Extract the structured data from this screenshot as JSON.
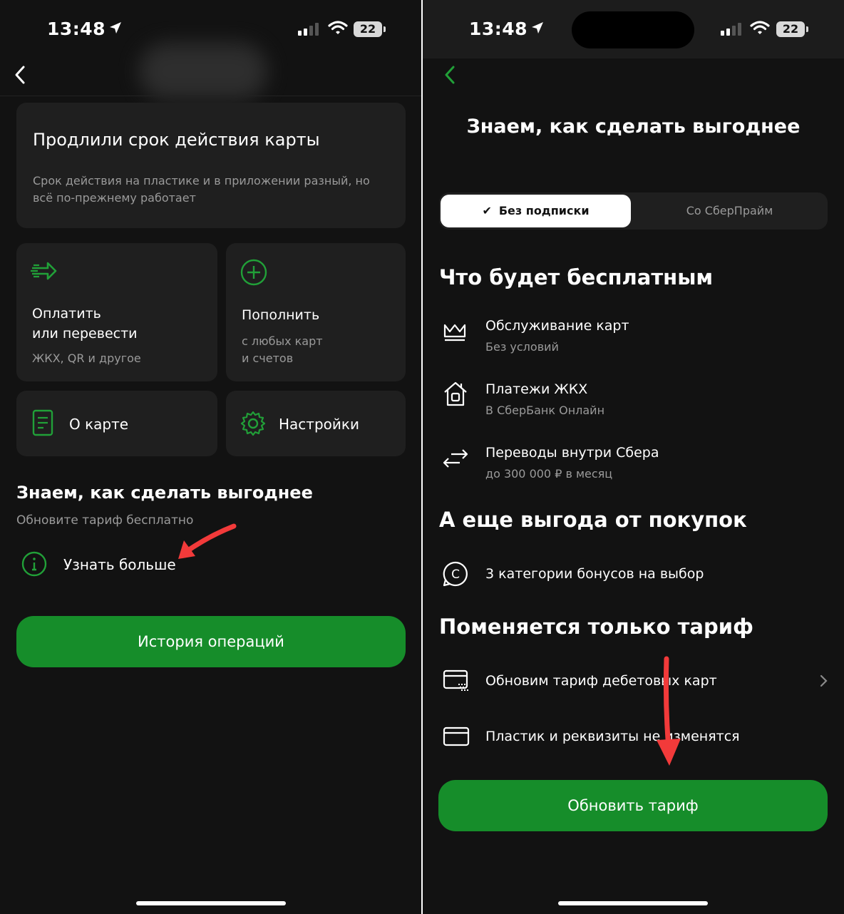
{
  "left": {
    "status": {
      "time": "13:48",
      "battery": "22"
    },
    "card_extended": {
      "title": "Продлили срок действия карты",
      "subtitle_line1": "Срок действия на пластике и в приложении разный, но",
      "subtitle_line2": "всё по-прежнему работает"
    },
    "tile_pay": {
      "title_line1": "Оплатить",
      "title_line2": "или перевести",
      "subtitle": "ЖКХ, QR и другое"
    },
    "tile_topup": {
      "title": "Пополнить",
      "subtitle_line1": "с любых карт",
      "subtitle_line2": "и счетов"
    },
    "tile_about": {
      "label": "О карте"
    },
    "tile_settings": {
      "label": "Настройки"
    },
    "promo": {
      "title": "Знаем, как сделать выгоднее",
      "subtitle": "Обновите тариф бесплатно",
      "link": "Узнать больше"
    },
    "history_button": "История операций"
  },
  "right": {
    "status": {
      "time": "13:48",
      "battery": "22"
    },
    "title": "Знаем, как сделать выгоднее",
    "segments": [
      {
        "label": "Без подписки",
        "selected": true
      },
      {
        "label": "Со СберПрайм",
        "selected": false
      }
    ],
    "section_free": {
      "title": "Что будет бесплатным",
      "items": [
        {
          "title": "Обслуживание карт",
          "subtitle": "Без условий",
          "icon": "crown-icon"
        },
        {
          "title": "Платежи ЖКХ",
          "subtitle": "В СберБанк Онлайн",
          "icon": "house-icon"
        },
        {
          "title": "Переводы внутри Сбера",
          "subtitle": "до 300 000 ₽ в месяц",
          "icon": "transfer-arrows-icon"
        }
      ]
    },
    "section_bonus": {
      "title": "А еще выгода от покупок",
      "items": [
        {
          "title": "3 категории бонусов на выбор",
          "icon": "bonus-c-icon"
        }
      ]
    },
    "section_tariff": {
      "title": "Поменяется только тариф",
      "items": [
        {
          "title": "Обновим тариф дебетовых карт",
          "icon": "cards-icon"
        },
        {
          "title": "Пластик и реквизиты не изменятся",
          "icon": "card-icon"
        }
      ]
    },
    "update_button": "Обновить тариф"
  },
  "colors": {
    "accent": "#21a038",
    "button": "#168d2a",
    "arrow": "#f23a3a",
    "background": "#121212",
    "card": "#1f1f1f"
  }
}
